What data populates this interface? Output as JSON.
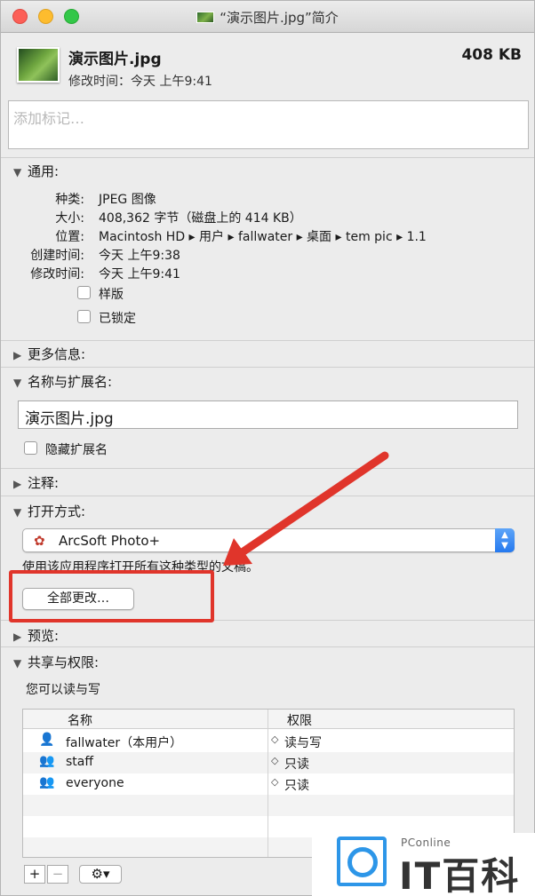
{
  "window": {
    "title": "“演示图片.jpg”简介"
  },
  "header": {
    "filename": "演示图片.jpg",
    "modified": "修改时间：今天 上午9:41",
    "size": "408 KB"
  },
  "tags": {
    "placeholder": "添加标记…"
  },
  "general": {
    "label": "通用:",
    "fields": [
      {
        "label": "种类:",
        "value": "JPEG 图像"
      },
      {
        "label": "大小:",
        "value": "408,362 字节（磁盘上的 414 KB）"
      },
      {
        "label": "位置:",
        "value": "Macintosh HD ▸ 用户 ▸ fallwater ▸ 桌面 ▸ tem pic ▸ 1.1"
      },
      {
        "label": "创建时间:",
        "value": "今天 上午9:38"
      },
      {
        "label": "修改时间:",
        "value": "今天 上午9:41"
      }
    ],
    "checkboxes": [
      {
        "label": "样版"
      },
      {
        "label": "已锁定"
      }
    ]
  },
  "more_info": {
    "label": "更多信息:"
  },
  "name_ext": {
    "label": "名称与扩展名:",
    "value": "演示图片.jpg",
    "hide_ext_label": "隐藏扩展名"
  },
  "comments": {
    "label": "注释:"
  },
  "open_with": {
    "label": "打开方式:",
    "app": "ArcSoft Photo+",
    "hint": "使用该应用程序打开所有这种类型的文稿。",
    "change_all_label": "全部更改…"
  },
  "preview": {
    "label": "预览:"
  },
  "sharing": {
    "label": "共享与权限:",
    "caption": "您可以读与写",
    "col_name": "名称",
    "col_perm": "权限",
    "rows": [
      {
        "name": "fallwater（本用户）",
        "perm": "读与写"
      },
      {
        "name": "staff",
        "perm": "只读"
      },
      {
        "name": "everyone",
        "perm": "只读"
      }
    ]
  },
  "toolbar": {
    "add": "+",
    "remove": "−",
    "gear": "⚙︎▾"
  },
  "watermark": {
    "brand": "PConline",
    "name": "IT百科"
  },
  "colors": {
    "highlight": "#e0352b",
    "accent": "#2579ef"
  }
}
